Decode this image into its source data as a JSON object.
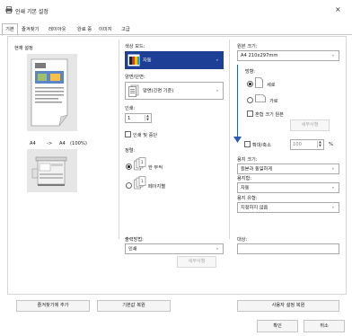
{
  "window": {
    "title": "인쇄 기본 설정",
    "close_glyph": "×"
  },
  "tabs": [
    "기본",
    "즐겨찾기",
    "레이아웃",
    "완료 중",
    "이미지",
    "고급"
  ],
  "preview": {
    "heading": "현재 설정",
    "source_size": "A4",
    "arrow": "->",
    "target_size": "A4",
    "zoom": "(100%)"
  },
  "color_mode": {
    "label": "색상 모드:",
    "value": "자동"
  },
  "duplex": {
    "label": "양면/단면:",
    "value": "양면(긴면 기준)"
  },
  "copies": {
    "label": "인쇄:",
    "value": "1",
    "pause_label": "인쇄 및 중단"
  },
  "sort": {
    "label": "정렬:",
    "options": [
      {
        "label": "한 부씩",
        "selected": true
      },
      {
        "label": "페이지별",
        "selected": false
      }
    ]
  },
  "output_method": {
    "label": "출력방법:",
    "value": "인쇄",
    "detail_button": "세부사항"
  },
  "target": {
    "label": "대상:",
    "value": ""
  },
  "original_size": {
    "label": "원본 크기:",
    "value": "A4 210x297mm"
  },
  "orientation": {
    "label": "방향:",
    "options": [
      {
        "label": "세로",
        "selected": true
      },
      {
        "label": "가로",
        "selected": false
      }
    ]
  },
  "mixed_size": {
    "label": "혼합 크기 원본",
    "detail_button": "세부사항"
  },
  "zoom": {
    "label": "확대/축소",
    "value": "100",
    "unit": "%"
  },
  "paper_size": {
    "label": "용지 크기:",
    "value": "원본과 동일하게"
  },
  "tray": {
    "label": "용지함:",
    "value": "자동"
  },
  "paper_type": {
    "label": "용지 유형:",
    "value": "지정하지 않음"
  },
  "footer": {
    "add_favorite": "즐겨찾기에 추가",
    "restore_default": "기본값 복원",
    "restore_user": "사용자 설정 복원",
    "ok": "확인",
    "cancel": "취소"
  },
  "colors": {
    "accent": "#1d3f95"
  }
}
